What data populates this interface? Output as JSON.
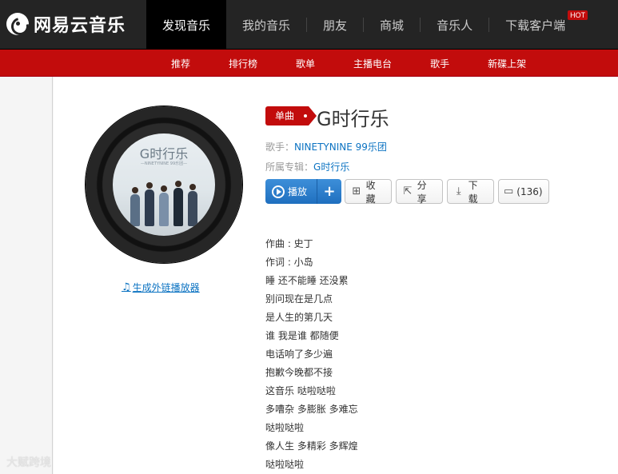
{
  "brand": {
    "name": "网易云音乐"
  },
  "nav": {
    "items": [
      {
        "label": "发现音乐",
        "active": true
      },
      {
        "label": "我的音乐"
      },
      {
        "label": "朋友"
      },
      {
        "label": "商城"
      },
      {
        "label": "音乐人"
      },
      {
        "label": "下载客户端",
        "badge": "HOT"
      }
    ]
  },
  "subnav": {
    "items": [
      {
        "label": "推荐"
      },
      {
        "label": "排行榜"
      },
      {
        "label": "歌单"
      },
      {
        "label": "主播电台"
      },
      {
        "label": "歌手"
      },
      {
        "label": "新碟上架"
      }
    ]
  },
  "album": {
    "cover_title": "G时行乐",
    "cover_subtitle": "—NINETYNINE 99乐团—",
    "external_link": "生成外链播放器"
  },
  "song": {
    "tag": "单曲",
    "title": "G时行乐",
    "artist_label": "歌手：",
    "artist": "NINETYNINE 99乐团",
    "album_label": "所属专辑：",
    "album": "G时行乐"
  },
  "actions": {
    "play": "播放",
    "add": "+",
    "favorite": "收藏",
    "share": "分享",
    "download": "下载",
    "comments": "(136)"
  },
  "lyrics": [
    "作曲 : 史丁",
    "作词 : 小岛",
    "睡 还不能睡 还没累",
    "别问现在是几点",
    "是人生的第几天",
    "谁 我是谁 都随便",
    "电话响了多少遍",
    "抱歉今晚都不接",
    "这音乐 哒啦哒啦",
    "多嘈杂 多膨胀 多难忘",
    "哒啦哒啦",
    "像人生 多精彩 多辉煌",
    "哒啦哒啦"
  ],
  "watermark": "大赋跨境",
  "colors": {
    "brand_red": "#c20c0c",
    "link_blue": "#0c73c2",
    "nav_bg": "#242424"
  }
}
